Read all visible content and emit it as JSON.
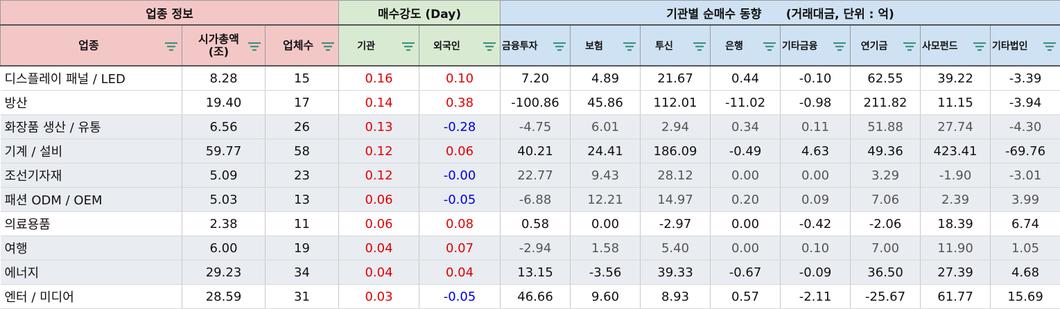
{
  "groups": {
    "industry_info": "업종 정보",
    "buying_strength": "매수강도 (Day)",
    "inst_trend": "기관별 순매수 동향      (거래대금, 단위 : 억)"
  },
  "columns": {
    "sector": "업종",
    "market_cap": "시가총액\n(조)",
    "company_count": "업체수",
    "institution": "기관",
    "foreign": "외국인",
    "fin_invest": "금융투자",
    "insurance": "보험",
    "trust": "투신",
    "bank": "은행",
    "other_fin": "기타금융",
    "pension": "연기금",
    "private_fund": "사모펀드",
    "other_corp": "기타법인"
  },
  "rows": [
    {
      "sector": "디스플레이 패널 / LED",
      "cap": "8.28",
      "count": "15",
      "inst": "0.16",
      "foreign": "0.10",
      "fin": "7.20",
      "ins": "4.89",
      "trust": "21.67",
      "bank": "0.44",
      "ofin": "-0.10",
      "pension": "62.55",
      "pf": "39.22",
      "ocorp": "-3.39",
      "shade": false,
      "fade": false
    },
    {
      "sector": "방산",
      "cap": "19.40",
      "count": "17",
      "inst": "0.14",
      "foreign": "0.38",
      "fin": "-100.86",
      "ins": "45.86",
      "trust": "112.01",
      "bank": "-11.02",
      "ofin": "-0.98",
      "pension": "211.82",
      "pf": "11.15",
      "ocorp": "-3.94",
      "shade": false,
      "fade": false
    },
    {
      "sector": "화장품 생산 / 유통",
      "cap": "6.56",
      "count": "26",
      "inst": "0.13",
      "foreign": "-0.28",
      "fin": "-4.75",
      "ins": "6.01",
      "trust": "2.94",
      "bank": "0.34",
      "ofin": "0.11",
      "pension": "51.88",
      "pf": "27.74",
      "ocorp": "-4.30",
      "shade": true,
      "fade": true
    },
    {
      "sector": "기계 / 설비",
      "cap": "59.77",
      "count": "58",
      "inst": "0.12",
      "foreign": "0.06",
      "fin": "40.21",
      "ins": "24.41",
      "trust": "186.09",
      "bank": "-0.49",
      "ofin": "4.63",
      "pension": "49.36",
      "pf": "423.41",
      "ocorp": "-69.76",
      "shade": true,
      "fade": false
    },
    {
      "sector": "조선기자재",
      "cap": "5.09",
      "count": "23",
      "inst": "0.12",
      "foreign": "-0.00",
      "fin": "22.77",
      "ins": "9.43",
      "trust": "28.12",
      "bank": "0.00",
      "ofin": "0.00",
      "pension": "3.29",
      "pf": "-1.90",
      "ocorp": "-3.01",
      "shade": true,
      "fade": true
    },
    {
      "sector": "패션 ODM / OEM",
      "cap": "5.03",
      "count": "13",
      "inst": "0.06",
      "foreign": "-0.05",
      "fin": "-6.88",
      "ins": "12.21",
      "trust": "14.97",
      "bank": "0.20",
      "ofin": "0.09",
      "pension": "7.06",
      "pf": "2.39",
      "ocorp": "3.99",
      "shade": true,
      "fade": true
    },
    {
      "sector": "의료용품",
      "cap": "2.38",
      "count": "11",
      "inst": "0.06",
      "foreign": "0.08",
      "fin": "0.58",
      "ins": "0.00",
      "trust": "-2.97",
      "bank": "0.00",
      "ofin": "-0.42",
      "pension": "-2.06",
      "pf": "18.39",
      "ocorp": "6.74",
      "shade": false,
      "fade": false
    },
    {
      "sector": "여행",
      "cap": "6.00",
      "count": "19",
      "inst": "0.04",
      "foreign": "0.07",
      "fin": "-2.94",
      "ins": "1.58",
      "trust": "5.40",
      "bank": "0.00",
      "ofin": "0.10",
      "pension": "7.00",
      "pf": "11.90",
      "ocorp": "1.05",
      "shade": true,
      "fade": true
    },
    {
      "sector": "에너지",
      "cap": "29.23",
      "count": "34",
      "inst": "0.04",
      "foreign": "0.04",
      "fin": "13.15",
      "ins": "-3.56",
      "trust": "39.33",
      "bank": "-0.67",
      "ofin": "-0.09",
      "pension": "36.50",
      "pf": "27.39",
      "ocorp": "4.68",
      "shade": true,
      "fade": false
    },
    {
      "sector": "엔터 / 미디어",
      "cap": "28.59",
      "count": "31",
      "inst": "0.03",
      "foreign": "-0.05",
      "fin": "46.66",
      "ins": "9.60",
      "trust": "8.93",
      "bank": "0.57",
      "ofin": "-2.11",
      "pension": "-25.67",
      "pf": "61.77",
      "ocorp": "15.69",
      "shade": false,
      "fade": false
    }
  ],
  "colors": {
    "group_industry": "#f4c7c7",
    "group_strength": "#d9ead3",
    "group_inst": "#cfe2f3",
    "header_bg": "#f4c7c7",
    "positive": "#e00000",
    "negative": "#0000dd",
    "row_shade": "#e9ecf1",
    "filter_icon": "#2e8a75"
  },
  "icons": {
    "filter": "filter-icon"
  }
}
